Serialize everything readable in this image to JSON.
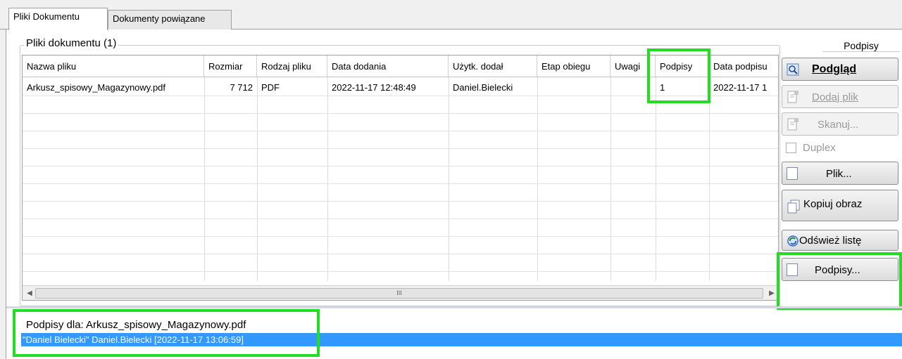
{
  "tabs": [
    {
      "label": "Pliki Dokumentu",
      "active": true
    },
    {
      "label": "Dokumenty powiązane",
      "active": false
    }
  ],
  "files_group": {
    "title": "Pliki dokumentu (1)"
  },
  "side_tab": {
    "label": "Podpisy"
  },
  "grid": {
    "columns": [
      "Nazwa pliku",
      "Rozmiar",
      "Rodzaj pliku",
      "Data dodania",
      "Użytk. dodał",
      "Etap obiegu",
      "Uwagi",
      "Podpisy",
      "Data podpisu"
    ],
    "rows": [
      [
        "Arkusz_spisowy_Magazynowy.pdf",
        "7 712",
        "PDF",
        "2022-11-17 12:48:49",
        "Daniel.Bielecki",
        "",
        "",
        "1",
        "2022-11-17 1"
      ]
    ],
    "scroll_thumb_glyph": "III"
  },
  "buttons": {
    "preview": "Podgląd",
    "add_file": "Dodaj plik",
    "scan": "Skanuj...",
    "duplex": "Duplex",
    "file": "Plik...",
    "copy_image": "Kopiuj obraz",
    "refresh": "Odśwież listę",
    "signatures": "Podpisy..."
  },
  "signatures_panel": {
    "heading": "Podpisy dla: Arkusz_spisowy_Magazynowy.pdf",
    "entries": [
      "\"Daniel Bielecki\" Daniel.Bielecki [2022-11-17 13:06:59]"
    ]
  },
  "colors": {
    "highlight": "#22dd22",
    "selection": "#3399ff"
  },
  "icons": {
    "preview": "magnifier-icon",
    "add_file": "document-add-icon",
    "scan": "scanner-icon",
    "refresh": "refresh-icon"
  }
}
